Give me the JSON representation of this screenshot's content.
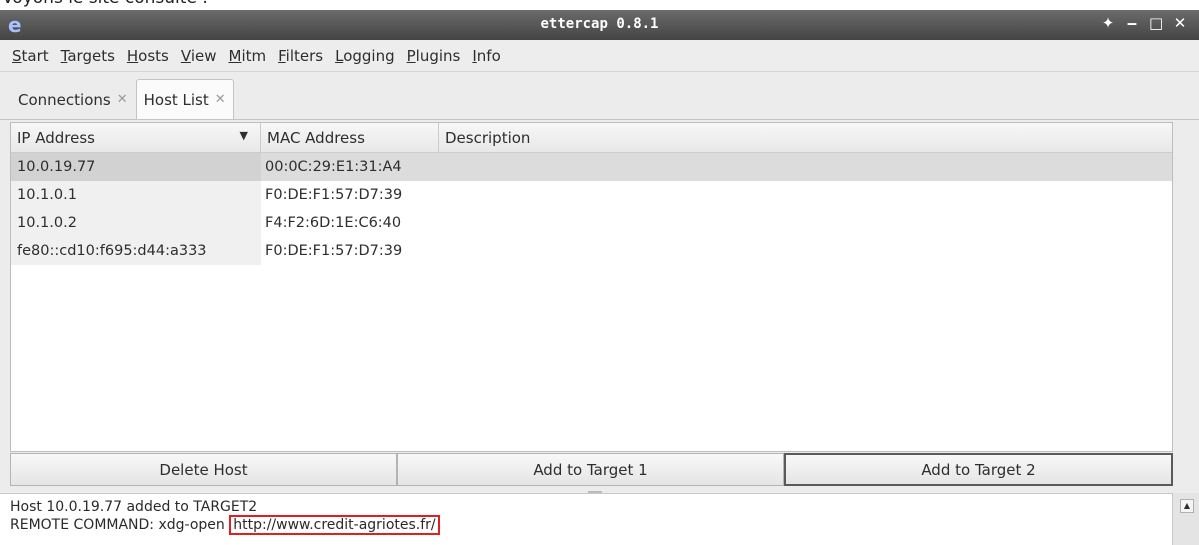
{
  "caption": "Voyons le site consulté :",
  "window": {
    "title": "ettercap 0.8.1",
    "controls": [
      "✦",
      "‒",
      "□",
      "✕"
    ]
  },
  "menu": [
    {
      "first": "S",
      "rest": "tart"
    },
    {
      "first": "T",
      "rest": "argets"
    },
    {
      "first": "H",
      "rest": "osts"
    },
    {
      "first": "V",
      "rest": "iew"
    },
    {
      "first": "M",
      "rest": "itm"
    },
    {
      "first": "F",
      "rest": "ilters"
    },
    {
      "first": "L",
      "rest": "ogging"
    },
    {
      "first": "P",
      "rest": "lugins"
    },
    {
      "first": "I",
      "rest": "nfo"
    }
  ],
  "tabs": [
    {
      "label": "Connections",
      "close": "✕"
    },
    {
      "label": "Host List",
      "close": "✕"
    }
  ],
  "table": {
    "columns": [
      "IP Address",
      "MAC Address",
      "Description"
    ],
    "sort_indicator": "▼",
    "rows": [
      {
        "ip": "10.0.19.77",
        "mac": "00:0C:29:E1:31:A4",
        "desc": ""
      },
      {
        "ip": "10.1.0.1",
        "mac": "F0:DE:F1:57:D7:39",
        "desc": ""
      },
      {
        "ip": "10.1.0.2",
        "mac": "F4:F2:6D:1E:C6:40",
        "desc": ""
      },
      {
        "ip": "fe80::cd10:f695:d44:a333",
        "mac": "F0:DE:F1:57:D7:39",
        "desc": ""
      }
    ]
  },
  "buttons": {
    "delete_host": "Delete Host",
    "add_target_1": "Add to Target 1",
    "add_target_2": "Add to Target 2"
  },
  "log": {
    "line1": "Host 10.0.19.77 added to TARGET2",
    "line2_prefix": "REMOTE COMMAND: xdg-open ",
    "line2_url": "http://www.credit-agriotes.fr/"
  },
  "colors": {
    "titlebar": "#4f4f4f",
    "url_highlight": "#e02020",
    "selected_row": "#dcdcdc"
  }
}
